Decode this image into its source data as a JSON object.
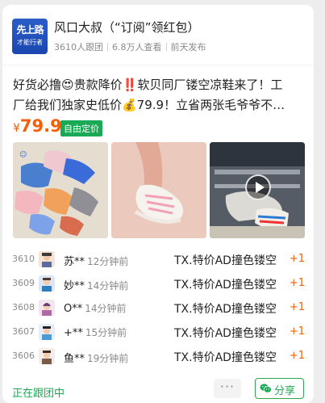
{
  "header": {
    "avatar_line1": "先上路",
    "avatar_line2": "才能行者",
    "title": "风口大叔（“订阅”领红包）",
    "followers": "3610人跟团",
    "views": "6.8万人查看",
    "posted": "前天发布"
  },
  "post": {
    "desc_line1": "好货必撸😍贵款降价‼️软贝同厂镂空凉鞋来了！工",
    "desc_line2": "厂给我们独家史低价💰79.9！立省两张毛爷爷不…",
    "price_symbol": "¥",
    "price": "79.9",
    "tag": "自由定价"
  },
  "images": [
    {
      "name": "kids-sandals-collection"
    },
    {
      "name": "sandal-on-foot"
    },
    {
      "name": "store-sandals-video"
    }
  ],
  "orders": [
    {
      "index": "3610",
      "name": "苏**",
      "time": "12分钟前",
      "product": "TX.特价AD撞色镂空",
      "count": "+1"
    },
    {
      "index": "3609",
      "name": "妙**",
      "time": "14分钟前",
      "product": "TX.特价AD撞色镂空",
      "count": "+1"
    },
    {
      "index": "3608",
      "name": "O**",
      "time": "14分钟前",
      "product": "TX.特价AD撞色镂空",
      "count": "+1"
    },
    {
      "index": "3607",
      "name": "+**",
      "time": "15分钟前",
      "product": "TX.特价AD撞色镂空",
      "count": "+1"
    },
    {
      "index": "3606",
      "name": "鱼**",
      "time": "19分钟前",
      "product": "TX.特价AD撞色镂空",
      "count": "+1"
    }
  ],
  "footer": {
    "status": "正在跟团中",
    "more_label": "···",
    "share_label": "分享"
  },
  "colors": {
    "accent_green": "#1aaa55",
    "price_orange": "#f2600a"
  }
}
